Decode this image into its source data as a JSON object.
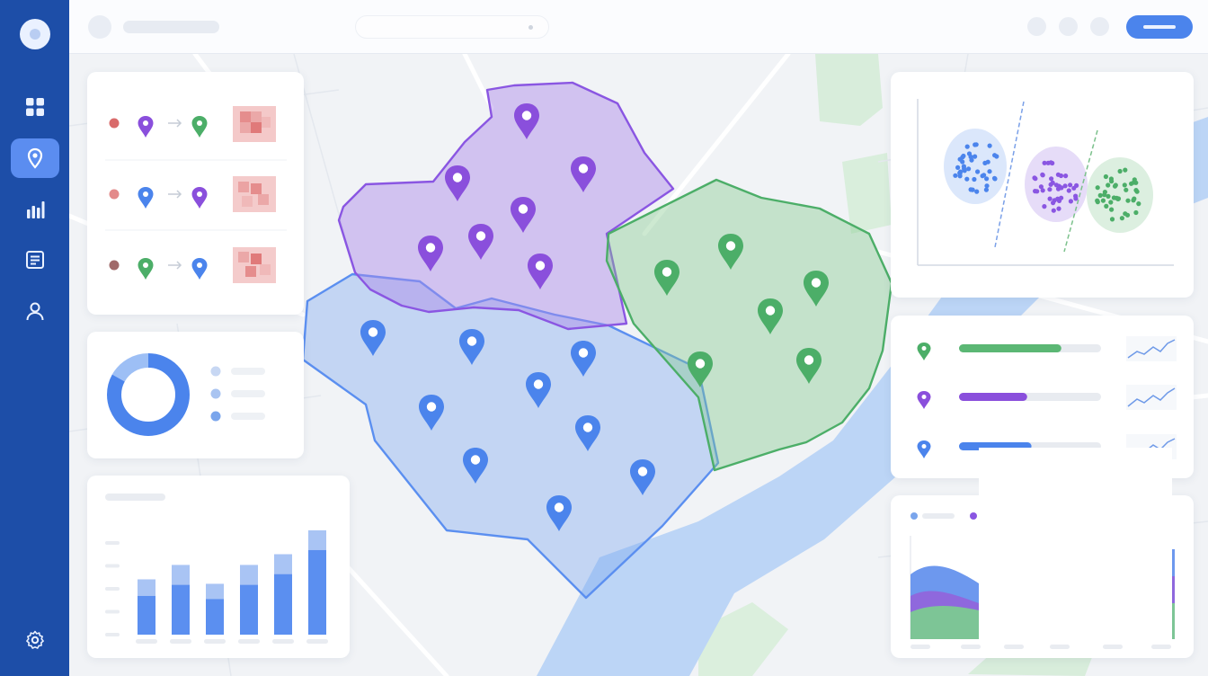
{
  "app": {
    "title": "",
    "search_placeholder": "",
    "primary_action_label": ""
  },
  "sidebar": {
    "items": [
      {
        "icon": "dashboard-grid-icon",
        "active": false
      },
      {
        "icon": "map-pin-icon",
        "active": true
      },
      {
        "icon": "bar-chart-icon",
        "active": false
      },
      {
        "icon": "report-list-icon",
        "active": false
      },
      {
        "icon": "user-icon",
        "active": false
      }
    ],
    "footer_icon": "settings-gear-icon"
  },
  "colors": {
    "sidebar": "#1d4ea8",
    "accent_blue": "#4b84ec",
    "cluster_blue": "#5b8ff0",
    "cluster_purple": "#8a56e2",
    "cluster_green": "#4cae68",
    "heat_red": "#e07a7a",
    "river": "#bcd5f6",
    "park": "#d8eddb"
  },
  "map": {
    "regions": [
      {
        "name": "",
        "color": "purple",
        "markers": 8
      },
      {
        "name": "",
        "color": "green",
        "markers": 7
      },
      {
        "name": "",
        "color": "blue",
        "markers": 11
      }
    ]
  },
  "routes": [
    {
      "from": "purple",
      "to": "green",
      "status": "#d96b6b"
    },
    {
      "from": "blue",
      "to": "purple",
      "status": "#e38a8a"
    },
    {
      "from": "green",
      "to": "blue",
      "status": "#a06a6a"
    }
  ],
  "donut": {
    "segments": [
      {
        "color": "#4b84ec",
        "fraction": 0.83
      },
      {
        "color": "#9dbff5",
        "fraction": 0.17
      }
    ]
  },
  "cluster_metrics": [
    {
      "color": "green",
      "progress": 0.72
    },
    {
      "color": "purple",
      "progress": 0.48
    },
    {
      "color": "blue",
      "progress": 0.51
    }
  ],
  "chart_data": [
    {
      "type": "bar",
      "title": "",
      "categories": [
        "",
        "",
        "",
        "",
        "",
        ""
      ],
      "values": [
        62,
        78,
        57,
        78,
        90,
        117
      ],
      "ylim": [
        0,
        120
      ],
      "grid": false
    },
    {
      "type": "scatter",
      "title": "",
      "series": [
        {
          "color": "#4b84ec",
          "points": 40
        },
        {
          "color": "#8a56e2",
          "points": 40
        },
        {
          "color": "#4cae68",
          "points": 40
        }
      ],
      "grid": false
    },
    {
      "type": "area",
      "title": "",
      "series": [
        {
          "color": "#4cae68"
        },
        {
          "color": "#8a56e2"
        },
        {
          "color": "#5b8ff0"
        }
      ]
    }
  ]
}
